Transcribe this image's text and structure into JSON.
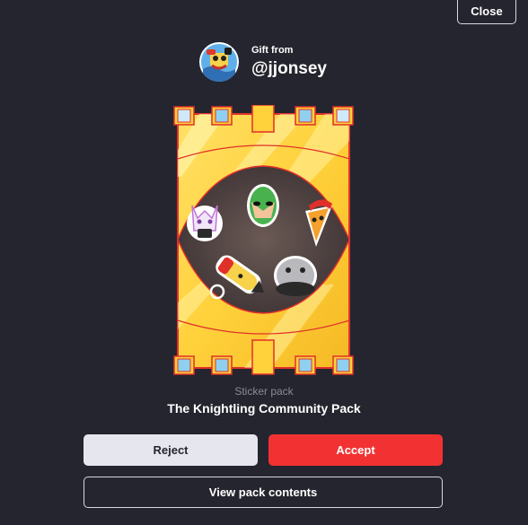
{
  "dialog": {
    "close_label": "Close"
  },
  "gift": {
    "from_label": "Gift from",
    "username": "@jjonsey"
  },
  "pack": {
    "type_label": "Sticker pack",
    "name": "The Knightling Community Pack"
  },
  "actions": {
    "reject_label": "Reject",
    "accept_label": "Accept",
    "view_contents_label": "View pack contents"
  },
  "colors": {
    "background": "#25252f",
    "accent_red": "#f23232",
    "reject_bg": "#e6e6ee",
    "pack_gold": "#ffd13a",
    "pack_outline": "#e0302a"
  },
  "icons": {
    "avatar": "user-avatar",
    "pack": "sticker-pack-castle-art"
  }
}
